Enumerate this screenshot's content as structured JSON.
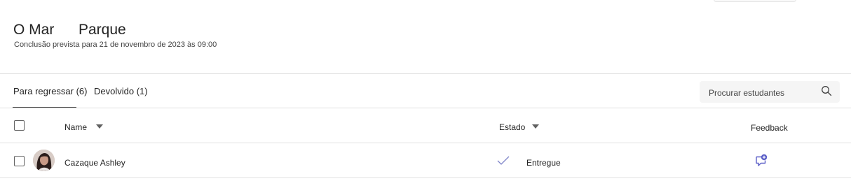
{
  "header": {
    "title_part1": "O Mar",
    "title_part2": "Parque",
    "due": "Conclusão prevista para 21 de novembro de 2023 às 09:00"
  },
  "tabs": [
    {
      "label": "Para regressar (6)",
      "selected": true
    },
    {
      "label": "Devolvido (1)",
      "selected": false
    }
  ],
  "search": {
    "placeholder": "Procurar estudantes",
    "icon": "search-icon"
  },
  "table": {
    "columns": {
      "name": "Name",
      "status": "Estado",
      "feedback": "Feedback"
    },
    "rows": [
      {
        "name": "Cazaque Ashley",
        "status": "Entregue",
        "status_icon": "checkmark-icon",
        "feedback_icon": "feedback-add-icon"
      }
    ]
  },
  "colors": {
    "accent": "#5b5fc7",
    "check": "#7f85c9",
    "divider": "#e1e1e1"
  }
}
